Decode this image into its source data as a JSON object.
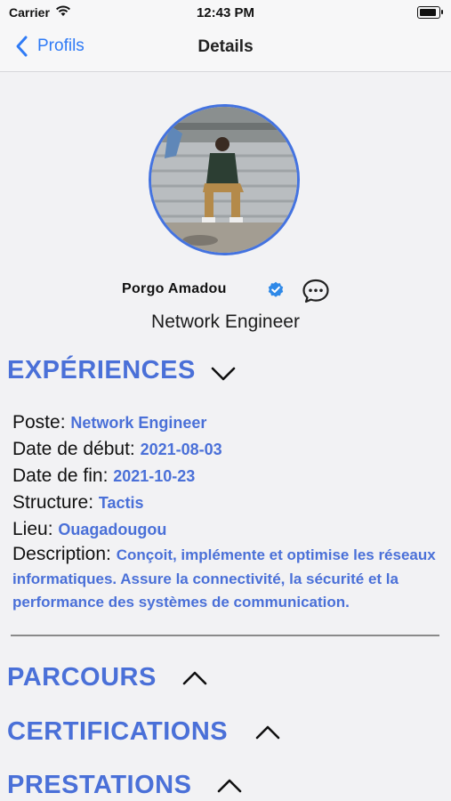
{
  "status": {
    "carrier": "Carrier",
    "time": "12:43 PM",
    "battery_level": 1.0
  },
  "nav": {
    "back_label": "Profils",
    "title": "Details"
  },
  "profile": {
    "name": "Porgo  Amadou",
    "role": "Network Engineer",
    "verified": true
  },
  "sections": {
    "experiences": "EXPÉRIENCES",
    "parcours": "PARCOURS",
    "certifications": "CERTIFICATIONS",
    "prestations": "PRESTATIONS"
  },
  "experience": {
    "poste_label": "Poste: ",
    "poste": "Network Engineer",
    "debut_label": "Date de début: ",
    "debut": "2021-08-03",
    "fin_label": "Date de fin: ",
    "fin": "2021-10-23",
    "structure_label": "Structure: ",
    "structure": "Tactis",
    "lieu_label": "Lieu: ",
    "lieu": "Ouagadougou",
    "description_label": "Description: ",
    "description": "Conçoit, implémente et optimise les réseaux informatiques. Assure la connectivité, la sécurité et la performance des systèmes de communication."
  },
  "colors": {
    "accent": "#4a70d8",
    "ios_blue": "#2f7bf6"
  }
}
